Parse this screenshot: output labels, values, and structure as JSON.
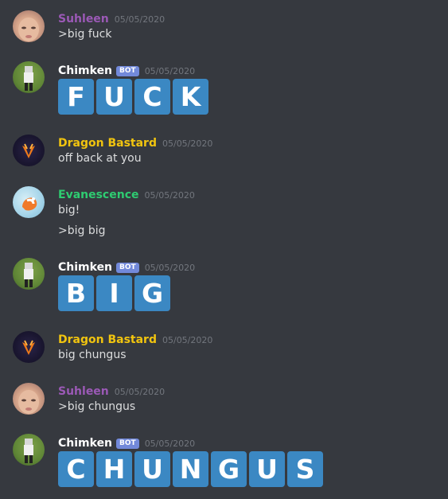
{
  "colors": {
    "background": "#36393f",
    "text": "#dcddde",
    "timestamp": "#72767d",
    "bot_tag": "#7289da",
    "tile": "#3b88c3",
    "suhleen": "#9b59b6",
    "chimken": "#ffffff",
    "dragon_bastard": "#f1c40f",
    "evanescence": "#2ecc71"
  },
  "messages": [
    {
      "author": "Suhleen",
      "timestamp": "05/05/2020",
      "lines": [
        ">big fuck"
      ]
    },
    {
      "author": "Chimken",
      "bot_tag": "BOT",
      "timestamp": "05/05/2020",
      "tiles": [
        "F",
        "U",
        "C",
        "K"
      ]
    },
    {
      "author": "Dragon Bastard",
      "timestamp": "05/05/2020",
      "lines": [
        "off back at you"
      ]
    },
    {
      "author": "Evanescence",
      "timestamp": "05/05/2020",
      "lines": [
        "big!",
        ">big big"
      ]
    },
    {
      "author": "Chimken",
      "bot_tag": "BOT",
      "timestamp": "05/05/2020",
      "tiles": [
        "B",
        "I",
        "G"
      ]
    },
    {
      "author": "Dragon Bastard",
      "timestamp": "05/05/2020",
      "lines": [
        "big chungus"
      ]
    },
    {
      "author": "Suhleen",
      "timestamp": "05/05/2020",
      "lines": [
        ">big chungus"
      ]
    },
    {
      "author": "Chimken",
      "bot_tag": "BOT",
      "timestamp": "05/05/2020",
      "tiles": [
        "C",
        "H",
        "U",
        "N",
        "G",
        "U",
        "S"
      ]
    }
  ]
}
